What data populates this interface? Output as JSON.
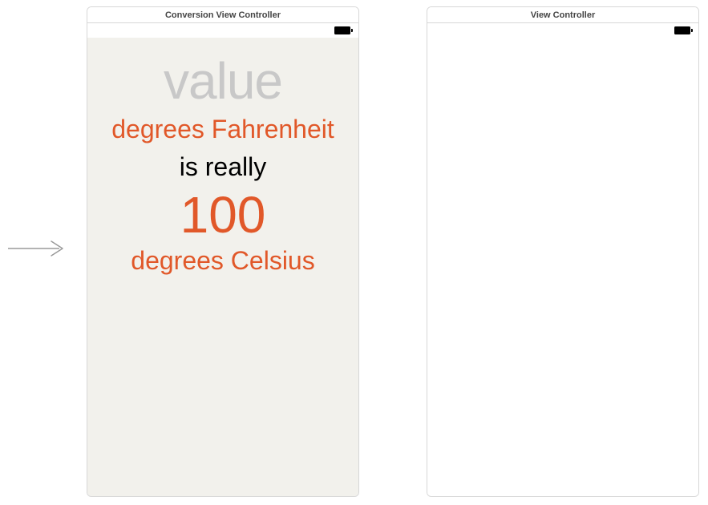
{
  "arrow": {
    "title": "initial-controller-arrow"
  },
  "left_scene": {
    "title": "Conversion View Controller",
    "background": "#f2f1ec",
    "accent": "#e15829",
    "value_placeholder": "value",
    "fahrenheit_label": "degrees Fahrenheit",
    "is_really_label": "is really",
    "celsius_value": "100",
    "celsius_label": "degrees Celsius"
  },
  "right_scene": {
    "title": "View Controller"
  }
}
